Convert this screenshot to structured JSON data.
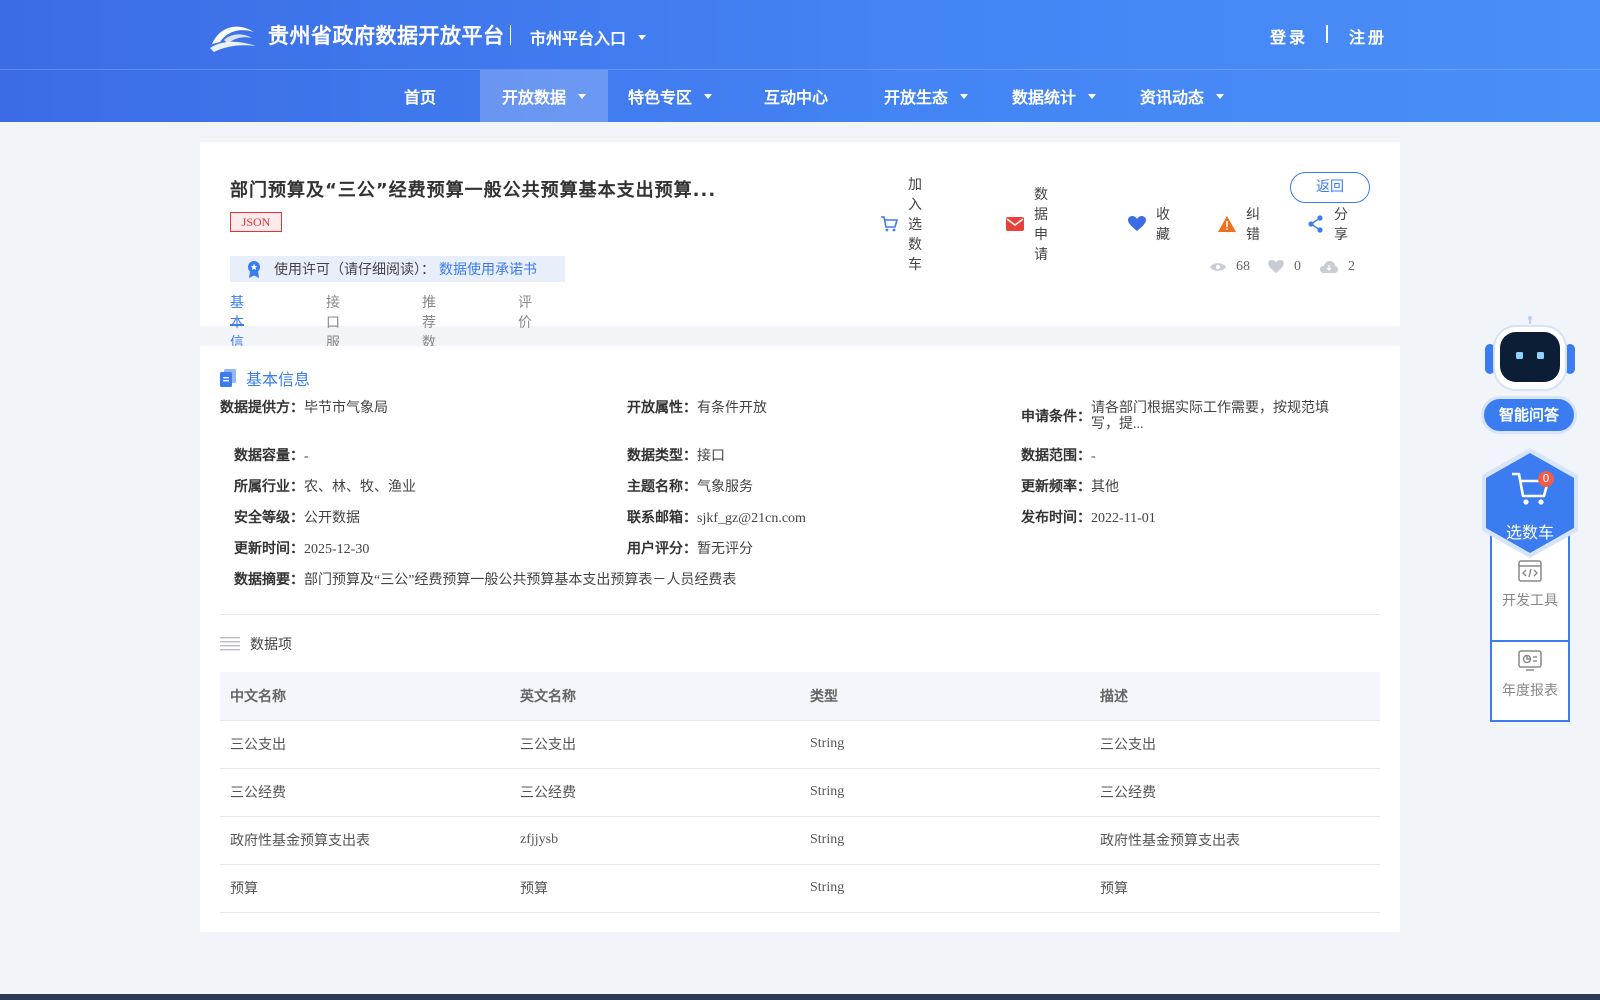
{
  "header": {
    "site_title": "贵州省政府数据开放平台",
    "city_entry": "市州平台入口",
    "login": "登录",
    "register": "注册"
  },
  "nav": {
    "items": [
      {
        "label": "首页"
      },
      {
        "label": "开放数据",
        "active": true
      },
      {
        "label": "特色专区"
      },
      {
        "label": "互动中心"
      },
      {
        "label": "开放生态"
      },
      {
        "label": "数据统计"
      },
      {
        "label": "资讯动态"
      }
    ]
  },
  "dataset": {
    "title": "部门预算及“三公”经费预算一般公共预算基本支出预算...",
    "format_tag": "JSON",
    "back_label": "返回",
    "actions": {
      "add_cart": "加入选数车",
      "apply": "数据申请",
      "favorite": "收藏",
      "report": "纠错",
      "share": "分享"
    },
    "license_label": "使用许可（请仔细阅读）：",
    "license_link": "数据使用承诺书",
    "stats": {
      "views": "68",
      "likes": "0",
      "downloads": "2"
    },
    "tabs": [
      "基本信息",
      "接口服务",
      "推荐数据",
      "评价"
    ]
  },
  "basic_info": {
    "section_title": "基本信息",
    "fields": {
      "provider": {
        "label": "数据提供方：",
        "value": "毕节市气象局"
      },
      "open_attr": {
        "label": "开放属性：",
        "value": "有条件开放"
      },
      "apply_cond": {
        "label": "申请条件：",
        "value": "请各部门根据实际工作需要，按规范填写，提..."
      },
      "capacity": {
        "label": "数据容量：",
        "value": "-"
      },
      "data_type": {
        "label": "数据类型：",
        "value": "接口"
      },
      "data_range": {
        "label": "数据范围：",
        "value": "-"
      },
      "industry": {
        "label": "所属行业：",
        "value": "农、林、牧、渔业"
      },
      "theme": {
        "label": "主题名称：",
        "value": "气象服务"
      },
      "frequency": {
        "label": "更新频率：",
        "value": "其他"
      },
      "security": {
        "label": "安全等级：",
        "value": "公开数据"
      },
      "email": {
        "label": "联系邮箱：",
        "value": "sjkf_gz@21cn.com"
      },
      "publish_time": {
        "label": "发布时间：",
        "value": "2022-11-01"
      },
      "update_time": {
        "label": "更新时间：",
        "value": "2025-12-30"
      },
      "rating": {
        "label": "用户评分：",
        "value": "暂无评分"
      },
      "summary": {
        "label": "数据摘要：",
        "value": "部门预算及“三公”经费预算一般公共预算基本支出预算表－人员经费表"
      }
    }
  },
  "data_items": {
    "title": "数据项",
    "columns": [
      "中文名称",
      "英文名称",
      "类型",
      "描述"
    ],
    "rows": [
      [
        "三公支出",
        "三公支出",
        "String",
        "三公支出"
      ],
      [
        "三公经费",
        "三公经费",
        "String",
        "三公经费"
      ],
      [
        "政府性基金预算支出表",
        "zfjjysb",
        "String",
        "政府性基金预算支出表"
      ],
      [
        "预算",
        "预算",
        "String",
        "预算"
      ]
    ]
  },
  "float_panel": {
    "ai_label": "智能问答",
    "cart_label": "选数车",
    "cart_count": "0",
    "dev_tools": "开发工具",
    "annual_report": "年度报表"
  },
  "colors": {
    "primary": "#3b7cf0",
    "header_start": "#3b6ce6",
    "tag_red": "#e2333a",
    "warn": "#f0701e"
  }
}
